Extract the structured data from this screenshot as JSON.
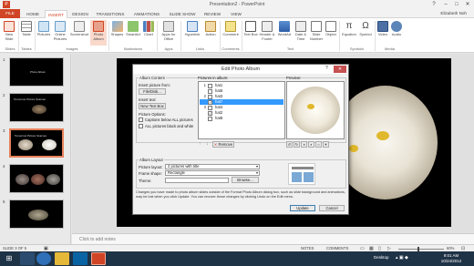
{
  "window": {
    "title": "Presentation2 - PowerPoint",
    "help": "?",
    "min": "–",
    "max": "□",
    "close": "✕"
  },
  "tabs": [
    "FILE",
    "HOME",
    "INSERT",
    "DESIGN",
    "TRANSITIONS",
    "ANIMATIONS",
    "SLIDE SHOW",
    "REVIEW",
    "VIEW"
  ],
  "user": "Elizabeth Noh",
  "ribbon": {
    "buttons": [
      "New Slide",
      "Table",
      "Pictures",
      "Online Pictures",
      "Screenshot",
      "Photo Album",
      "Shapes",
      "SmartArt",
      "Chart",
      "Apps for Office",
      "Hyperlink",
      "Action",
      "Comment",
      "Text Box",
      "Header & Footer",
      "WordArt",
      "Date & Time",
      "Slide Number",
      "Object",
      "Equation",
      "Symbol",
      "Video",
      "Audio"
    ],
    "groups": [
      "Slides",
      "Tables",
      "Images",
      "Illustrations",
      "Apps",
      "Links",
      "Comments",
      "Text",
      "Symbols",
      "Media"
    ]
  },
  "slides": [
    {
      "num": "1",
      "text": "Photo Album"
    },
    {
      "num": "2",
      "text": "Tomorrow Picture Scarves"
    },
    {
      "num": "3",
      "text": "Tomorrow Picture Scarves"
    },
    {
      "num": "4",
      "text": ""
    },
    {
      "num": "5",
      "text": ""
    }
  ],
  "notes_placeholder": "Click to add notes",
  "status": {
    "slide": "SLIDE 3 OF 5",
    "notes": "NOTES",
    "comments": "COMMENTS",
    "zoom": "60%"
  },
  "taskbar": {
    "desktop": "Desktop",
    "time": "9:01 AM",
    "date": "10/24/2012"
  },
  "dialog": {
    "title": "Edit Photo Album",
    "help": "?",
    "close": "✕",
    "album_content": "Album Content",
    "insert_picture_from": "Insert picture from:",
    "file_disk": "File/Disk...",
    "insert_text": "Insert text:",
    "new_text_box": "New Text Box",
    "picture_options": "Picture Options:",
    "captions_below": "Captions below ALL pictures",
    "all_black_white": "ALL pictures black and white",
    "pictures_in_album": "Pictures in album:",
    "preview": "Preview:",
    "pictures": [
      {
        "num": "1",
        "name": "hat1",
        "checked": false,
        "selected": false
      },
      {
        "num": "",
        "name": "hat6",
        "checked": false,
        "selected": false
      },
      {
        "num": "2",
        "name": "hat3",
        "checked": false,
        "selected": false
      },
      {
        "num": "",
        "name": "hat7",
        "checked": true,
        "selected": true
      },
      {
        "num": "3",
        "name": "hat4",
        "checked": false,
        "selected": false
      },
      {
        "num": "",
        "name": "hat2",
        "checked": true,
        "selected": false
      },
      {
        "num": "",
        "name": "hat8",
        "checked": false,
        "selected": false
      }
    ],
    "remove": "Remove",
    "album_layout": "Album Layout",
    "picture_layout_label": "Picture layout:",
    "picture_layout_value": "2 pictures with title",
    "frame_shape_label": "Frame shape:",
    "frame_shape_value": "Rectangle",
    "theme_label": "Theme:",
    "theme_value": "",
    "browse": "Browse...",
    "note": "Changes you have made to photo album slides outside of the Format Photo Album dialog box, such as slide background and animations, may be lost when you click Update. You can recover those changes by clicking Undo on the Edit menu.",
    "update": "Update",
    "cancel": "Cancel"
  },
  "colors": {
    "accent": "#d04525",
    "selection": "#3399ff",
    "taskbar": "#1f3347"
  }
}
